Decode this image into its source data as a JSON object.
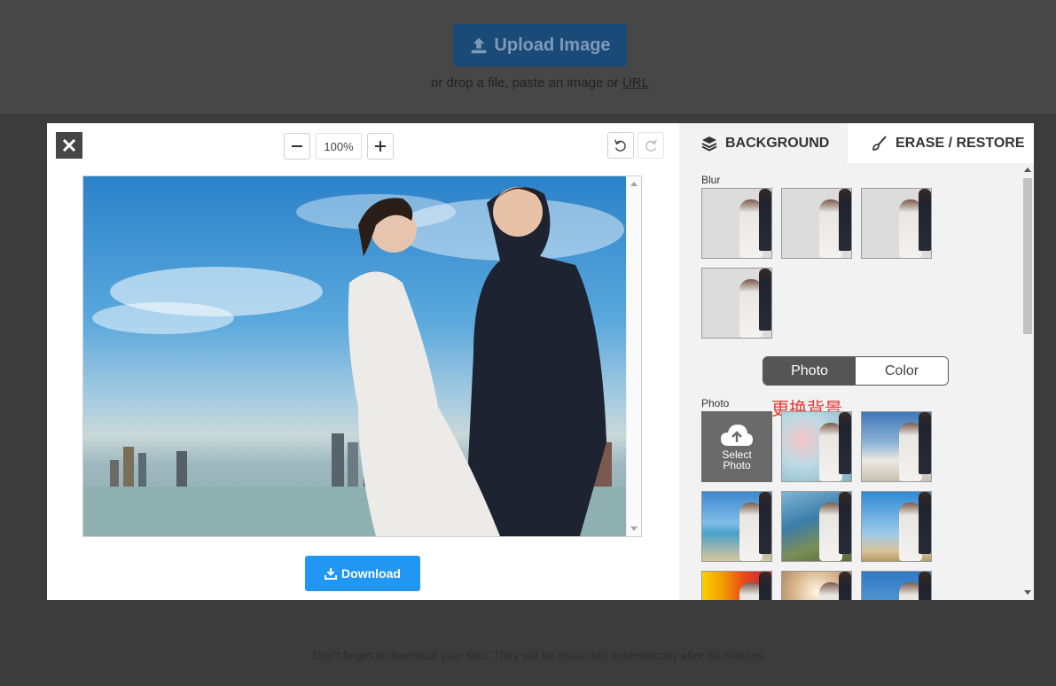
{
  "upload": {
    "label": "Upload Image"
  },
  "drop": {
    "prefix": "or drop a file, paste an image or ",
    "url_link": "URL"
  },
  "footer": {
    "note": "Don't forget to download your files. They will be discarded automatically after 60 minutes."
  },
  "toolbar": {
    "zoom": "100%"
  },
  "download": {
    "label": "Download"
  },
  "tabs": [
    {
      "label": "BACKGROUND"
    },
    {
      "label": "ERASE / RESTORE"
    }
  ],
  "panel": {
    "blur_label": "Blur",
    "toggle": {
      "photo": "Photo",
      "color": "Color",
      "active": "Photo"
    },
    "photo_label": "Photo",
    "annotation": "更换背景",
    "select_photo": {
      "line1": "Select",
      "line2": "Photo"
    }
  },
  "colors": {
    "accent": "#2196f3",
    "upload_bg": "#1a4a78",
    "annotation": "#e53935"
  }
}
